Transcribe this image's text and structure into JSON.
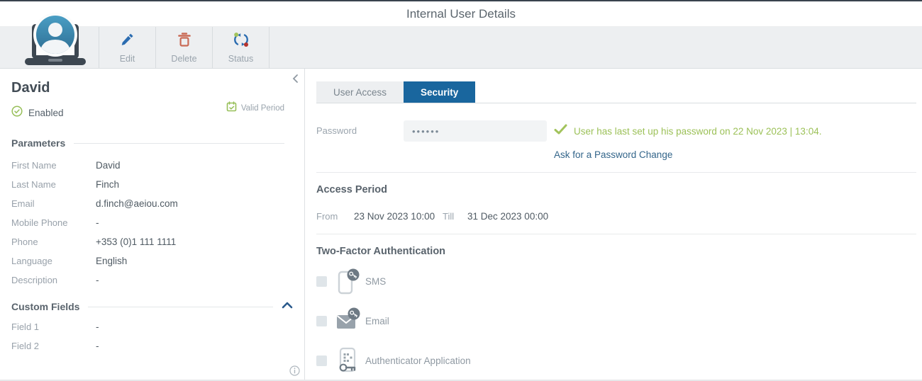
{
  "title": "Internal User Details",
  "toolbar": {
    "edit_label": "Edit",
    "delete_label": "Delete",
    "status_label": "Status"
  },
  "sidebar": {
    "user_name": "David",
    "status_text": "Enabled",
    "valid_period_label": "Valid Period",
    "parameters_title": "Parameters",
    "custom_fields_title": "Custom Fields",
    "params": [
      {
        "label": "First Name",
        "value": "David"
      },
      {
        "label": "Last Name",
        "value": "Finch"
      },
      {
        "label": "Email",
        "value": "d.finch@aeiou.com"
      },
      {
        "label": "Mobile Phone",
        "value": "-"
      },
      {
        "label": "Phone",
        "value": "+353 (0)1 111 1111"
      },
      {
        "label": "Language",
        "value": "English"
      },
      {
        "label": "Description",
        "value": "-"
      }
    ],
    "custom_fields": [
      {
        "label": "Field 1",
        "value": "-"
      },
      {
        "label": "Field 2",
        "value": "-"
      }
    ]
  },
  "main": {
    "tabs": [
      {
        "label": "User Access"
      },
      {
        "label": "Security"
      }
    ],
    "password": {
      "label": "Password",
      "value": "••••••",
      "message": "User has last set up his password on 22 Nov 2023 | 13:04.",
      "change_link": "Ask for a Password Change"
    },
    "access_period": {
      "title": "Access Period",
      "from_label": "From",
      "from_value": "23 Nov 2023 10:00",
      "till_label": "Till",
      "till_value": "31 Dec 2023 00:00"
    },
    "two_factor": {
      "title": "Two-Factor Authentication",
      "options": [
        {
          "label": "SMS",
          "checked": false
        },
        {
          "label": "Email",
          "checked": false
        },
        {
          "label": "Authenticator Application",
          "checked": false
        }
      ]
    }
  },
  "colors": {
    "accent_blue": "#19669E",
    "toolbar_blue": "#2B6CB0",
    "success_green": "#9CC158",
    "link_blue": "#33658A",
    "delete_red": "#C96A55"
  }
}
